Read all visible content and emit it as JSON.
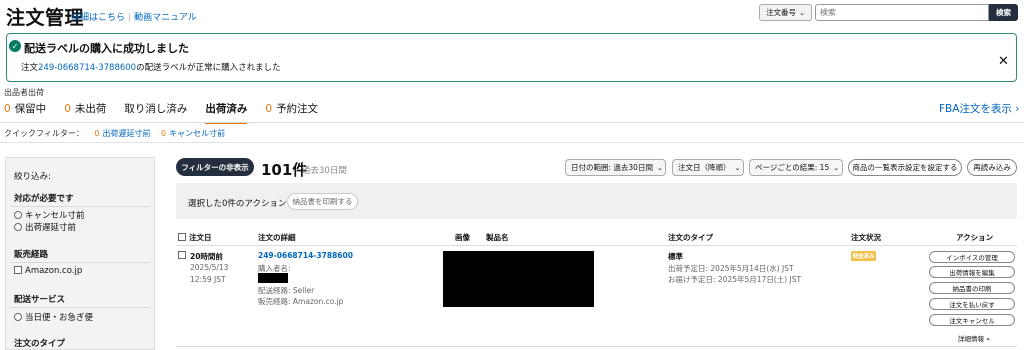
{
  "header": {
    "title": "注文管理",
    "link_details": "詳細はこちら",
    "link_video": "動画マニュアル",
    "search_field": "注文番号",
    "search_placeholder": "検索",
    "search_button": "検索"
  },
  "alert": {
    "title": "配送ラベルの購入に成功しました",
    "msg_prefix": "注文",
    "order_link": "249-0668714-3788600",
    "msg_suffix": "の配送ラベルが正常に購入されました"
  },
  "tabs": {
    "seller_label": "出品者出荷",
    "items": [
      {
        "count": "0",
        "label": "保留中"
      },
      {
        "count": "0",
        "label": "未出荷"
      },
      {
        "count": "",
        "label": "取り消し済み"
      },
      {
        "count": "",
        "label": "出荷済み"
      },
      {
        "count": "0",
        "label": "予約注文"
      }
    ],
    "fba": "FBA注文を表示 ›"
  },
  "quick_filter": {
    "label": "クイックフィルター：",
    "items": [
      {
        "count": "0",
        "label": "出荷遅延寸前"
      },
      {
        "count": "0",
        "label": "キャンセル寸前"
      }
    ]
  },
  "sidebar": {
    "narrow": "絞り込み:",
    "section1": "対応が必要です",
    "opt_cancel": "キャンセル寸前",
    "opt_delay": "出荷遅延寸前",
    "section2": "販売経路",
    "opt_amazon": "Amazon.co.jp",
    "section3": "配送サービス",
    "opt_sameday": "当日便・お急ぎ便",
    "section4": "注文のタイプ"
  },
  "toolbar": {
    "filter_toggle": "フィルターの非表示",
    "count": "101件",
    "count_sub": "過去30日間",
    "date_range": "日付の範囲: 過去30日間",
    "sort": "注文日（降順）",
    "per_page": "ページごとの結果: 15",
    "column_settings": "商品の一覧表示設定を設定する",
    "reload": "再読み込み"
  },
  "action_bar": {
    "text": "選択した0件のアクション",
    "print": "納品書を印刷する"
  },
  "table": {
    "headers": {
      "date": "注文日",
      "details": "注文の詳細",
      "image": "画像",
      "product": "製品名",
      "type": "注文のタイプ",
      "status": "注文状況",
      "action": "アクション"
    },
    "row": {
      "ago": "20時間前",
      "date": "2025/5/13",
      "time": "12:59 JST",
      "order_id": "249-0668714-3788600",
      "buyer_label": "購入者名:",
      "ship_route": "配送経路: Seller",
      "sales_route": "販売経路: Amazon.co.jp",
      "type": "標準",
      "ship_date": "出荷予定日: 2025年5月14日(水) JST",
      "delivery_date": "お届け予定日: 2025年5月17日(土) JST",
      "status": "発送済み",
      "actions": [
        "インボイスの管理",
        "出荷情報を編集",
        "納品書の印刷",
        "注文を払い戻す",
        "注文キャンセル"
      ],
      "more": "詳細情報 »"
    }
  }
}
